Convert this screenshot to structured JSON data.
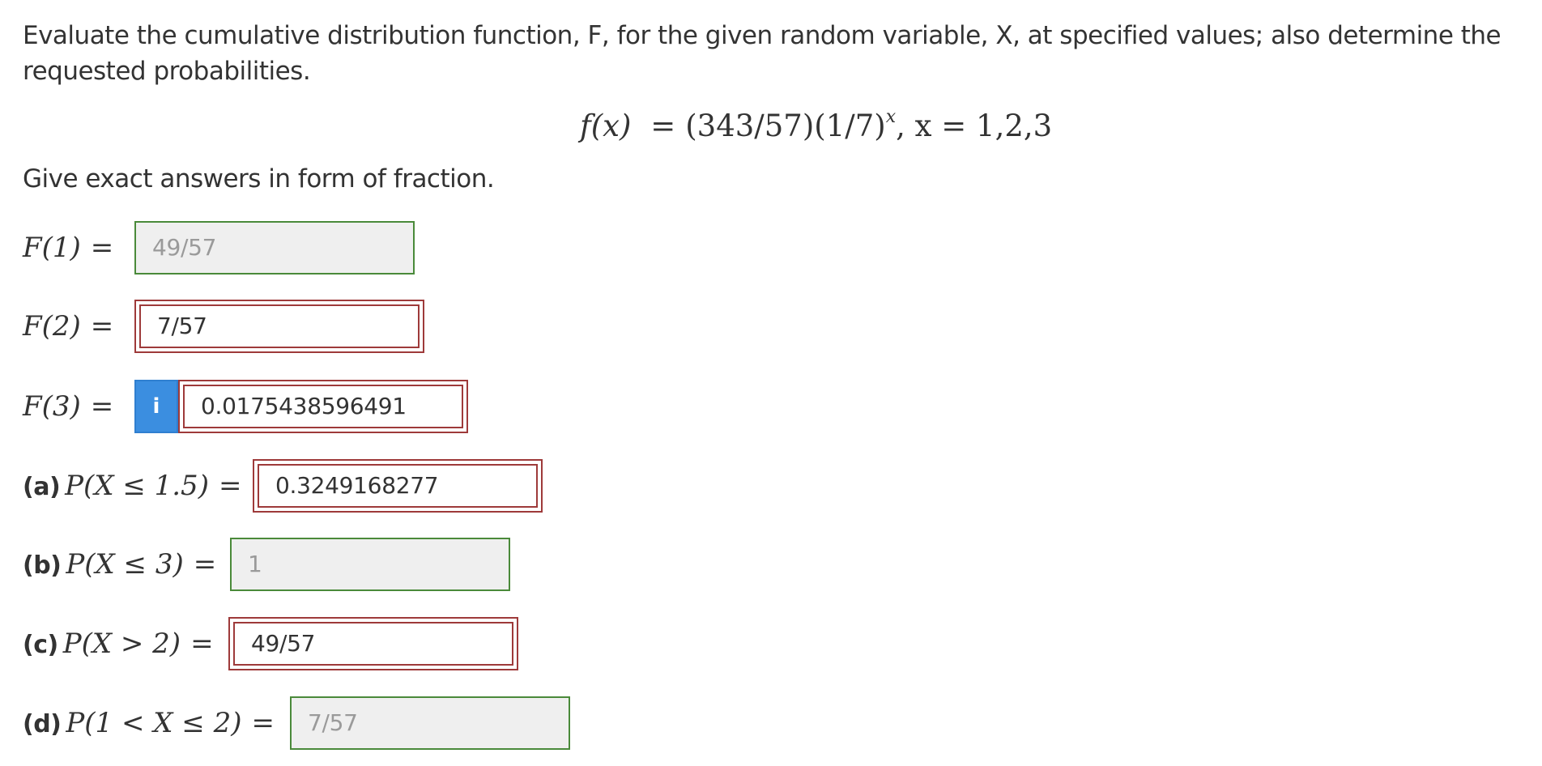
{
  "intro": "Evaluate the cumulative distribution function, F, for the given random variable, X, at specified values; also determine the requested probabilities.",
  "formula": {
    "lhs": "f(x)",
    "eq": "=",
    "body": "(343/57)(1/7)",
    "exp": "x",
    "tail": ", x = 1,2,3"
  },
  "instruction": "Give exact answers in form of fraction.",
  "rows": [
    {
      "part": "",
      "expr": "F(1)",
      "eq": "=",
      "answer": "49/57",
      "status": "correct"
    },
    {
      "part": "",
      "expr": "F(2)",
      "eq": "=",
      "answer": "7/57",
      "status": "incorrect"
    },
    {
      "part": "",
      "expr": "F(3)",
      "eq": "=",
      "answer": "0.0175438596491",
      "status": "incorrect",
      "info_icon": "info-icon",
      "info_glyph": "i"
    },
    {
      "part": "(a)",
      "expr": "P(X ≤ 1.5)",
      "eq": "=",
      "answer": "0.3249168277",
      "status": "incorrect"
    },
    {
      "part": "(b)",
      "expr": "P(X ≤ 3)",
      "eq": "=",
      "answer": "1",
      "status": "correct"
    },
    {
      "part": "(c)",
      "expr": "P(X > 2)",
      "eq": "=",
      "answer": "49/57",
      "status": "incorrect"
    },
    {
      "part": "(d)",
      "expr": "P(1 < X ≤ 2)",
      "eq": "=",
      "answer": "7/57",
      "status": "correct"
    }
  ],
  "colors": {
    "correct_border": "#4a8a3a",
    "incorrect_border": "#9e3a3a",
    "info_button": "#3b8ee0"
  }
}
